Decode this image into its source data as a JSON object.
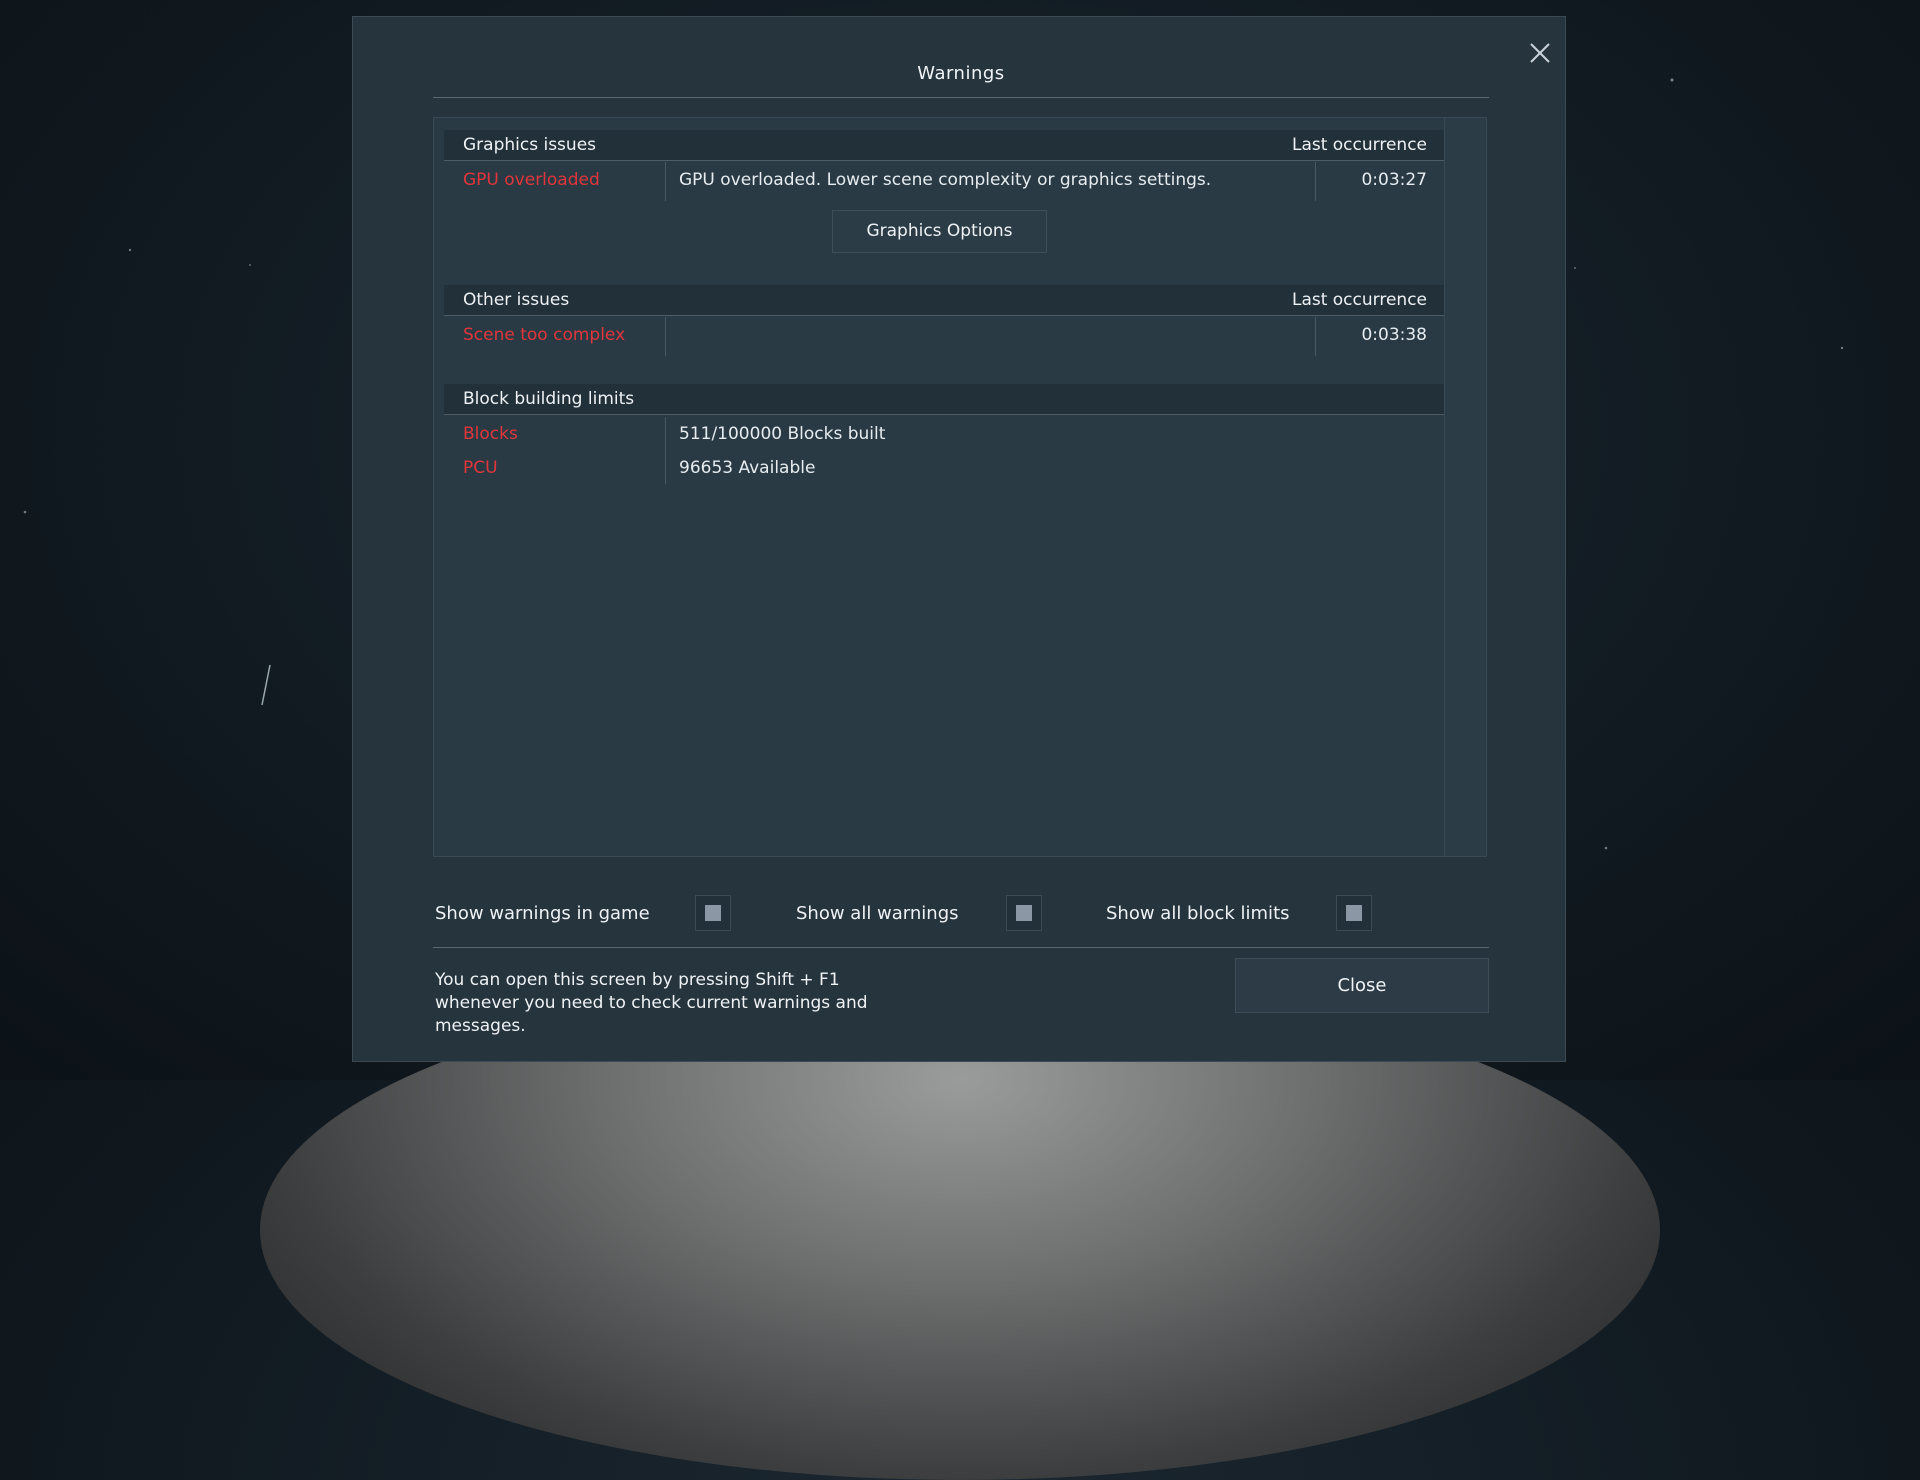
{
  "dialog": {
    "title": "Warnings",
    "close_icon": "close-icon"
  },
  "sections": {
    "graphics": {
      "header": "Graphics issues",
      "last_occurrence_label": "Last occurrence",
      "rows": [
        {
          "name": "GPU overloaded",
          "message": "GPU overloaded. Lower scene complexity or graphics settings.",
          "time": "0:03:27"
        }
      ],
      "button_label": "Graphics Options"
    },
    "other": {
      "header": "Other issues",
      "last_occurrence_label": "Last occurrence",
      "rows": [
        {
          "name": "Scene too complex",
          "message": "",
          "time": "0:03:38"
        }
      ]
    },
    "block_limits": {
      "header": "Block building limits",
      "rows": [
        {
          "name": "Blocks",
          "value": "511/100000 Blocks built"
        },
        {
          "name": "PCU",
          "value": "96653 Available"
        }
      ]
    }
  },
  "options": {
    "show_warnings_in_game": {
      "label": "Show warnings in game",
      "checked": true
    },
    "show_all_warnings": {
      "label": "Show all warnings",
      "checked": true
    },
    "show_all_block_limits": {
      "label": "Show all block limits",
      "checked": true
    }
  },
  "footer": {
    "hint": "You can open this screen by pressing Shift + F1\nwhenever you need to check current warnings and\nmessages.",
    "close_label": "Close"
  },
  "colors": {
    "warning_red": "#e0353a",
    "panel_bg": "#2a3a45",
    "dialog_bg": "#26343e"
  }
}
